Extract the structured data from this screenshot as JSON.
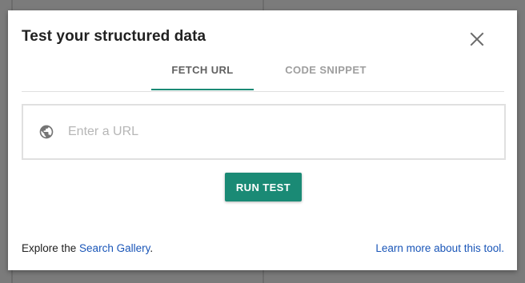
{
  "dialog": {
    "title": "Test your structured data",
    "close_icon": "close-icon"
  },
  "tabs": [
    {
      "label": "FETCH URL",
      "active": true
    },
    {
      "label": "CODE SNIPPET",
      "active": false
    }
  ],
  "url_input": {
    "placeholder": "Enter a URL",
    "value": "",
    "icon": "globe-icon"
  },
  "run_button": {
    "label": "RUN TEST"
  },
  "footer": {
    "explore_prefix": "Explore the ",
    "search_gallery_link": "Search Gallery",
    "explore_suffix": ".",
    "learn_more_link": "Learn more about this tool",
    "learn_more_suffix": "."
  },
  "colors": {
    "accent": "#1a8a75",
    "link": "#1a56b8",
    "overlay": "#7b7b7b"
  }
}
